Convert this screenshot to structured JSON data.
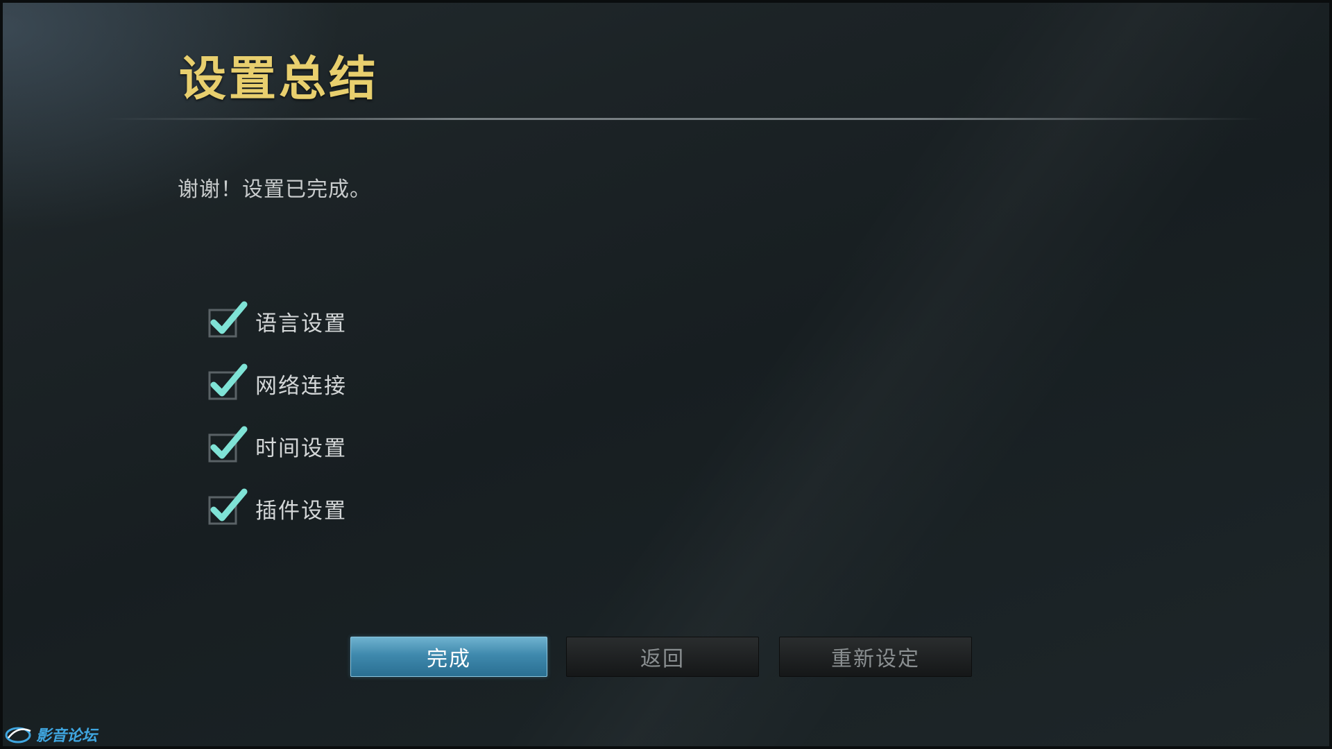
{
  "page": {
    "title": "设置总结",
    "message": "谢谢！设置已完成。"
  },
  "checklist": {
    "items": [
      {
        "label": "语言设置",
        "checked": true
      },
      {
        "label": "网络连接",
        "checked": true
      },
      {
        "label": "时间设置",
        "checked": true
      },
      {
        "label": "插件设置",
        "checked": true
      }
    ],
    "check_color": "#7fe3d6"
  },
  "buttons": {
    "done_label": "完成",
    "back_label": "返回",
    "reset_label": "重新设定",
    "focused": "完成"
  },
  "watermark": {
    "text": "影音论坛"
  },
  "colors": {
    "title": "#e8cf6e",
    "focus": "#3f89ad"
  }
}
